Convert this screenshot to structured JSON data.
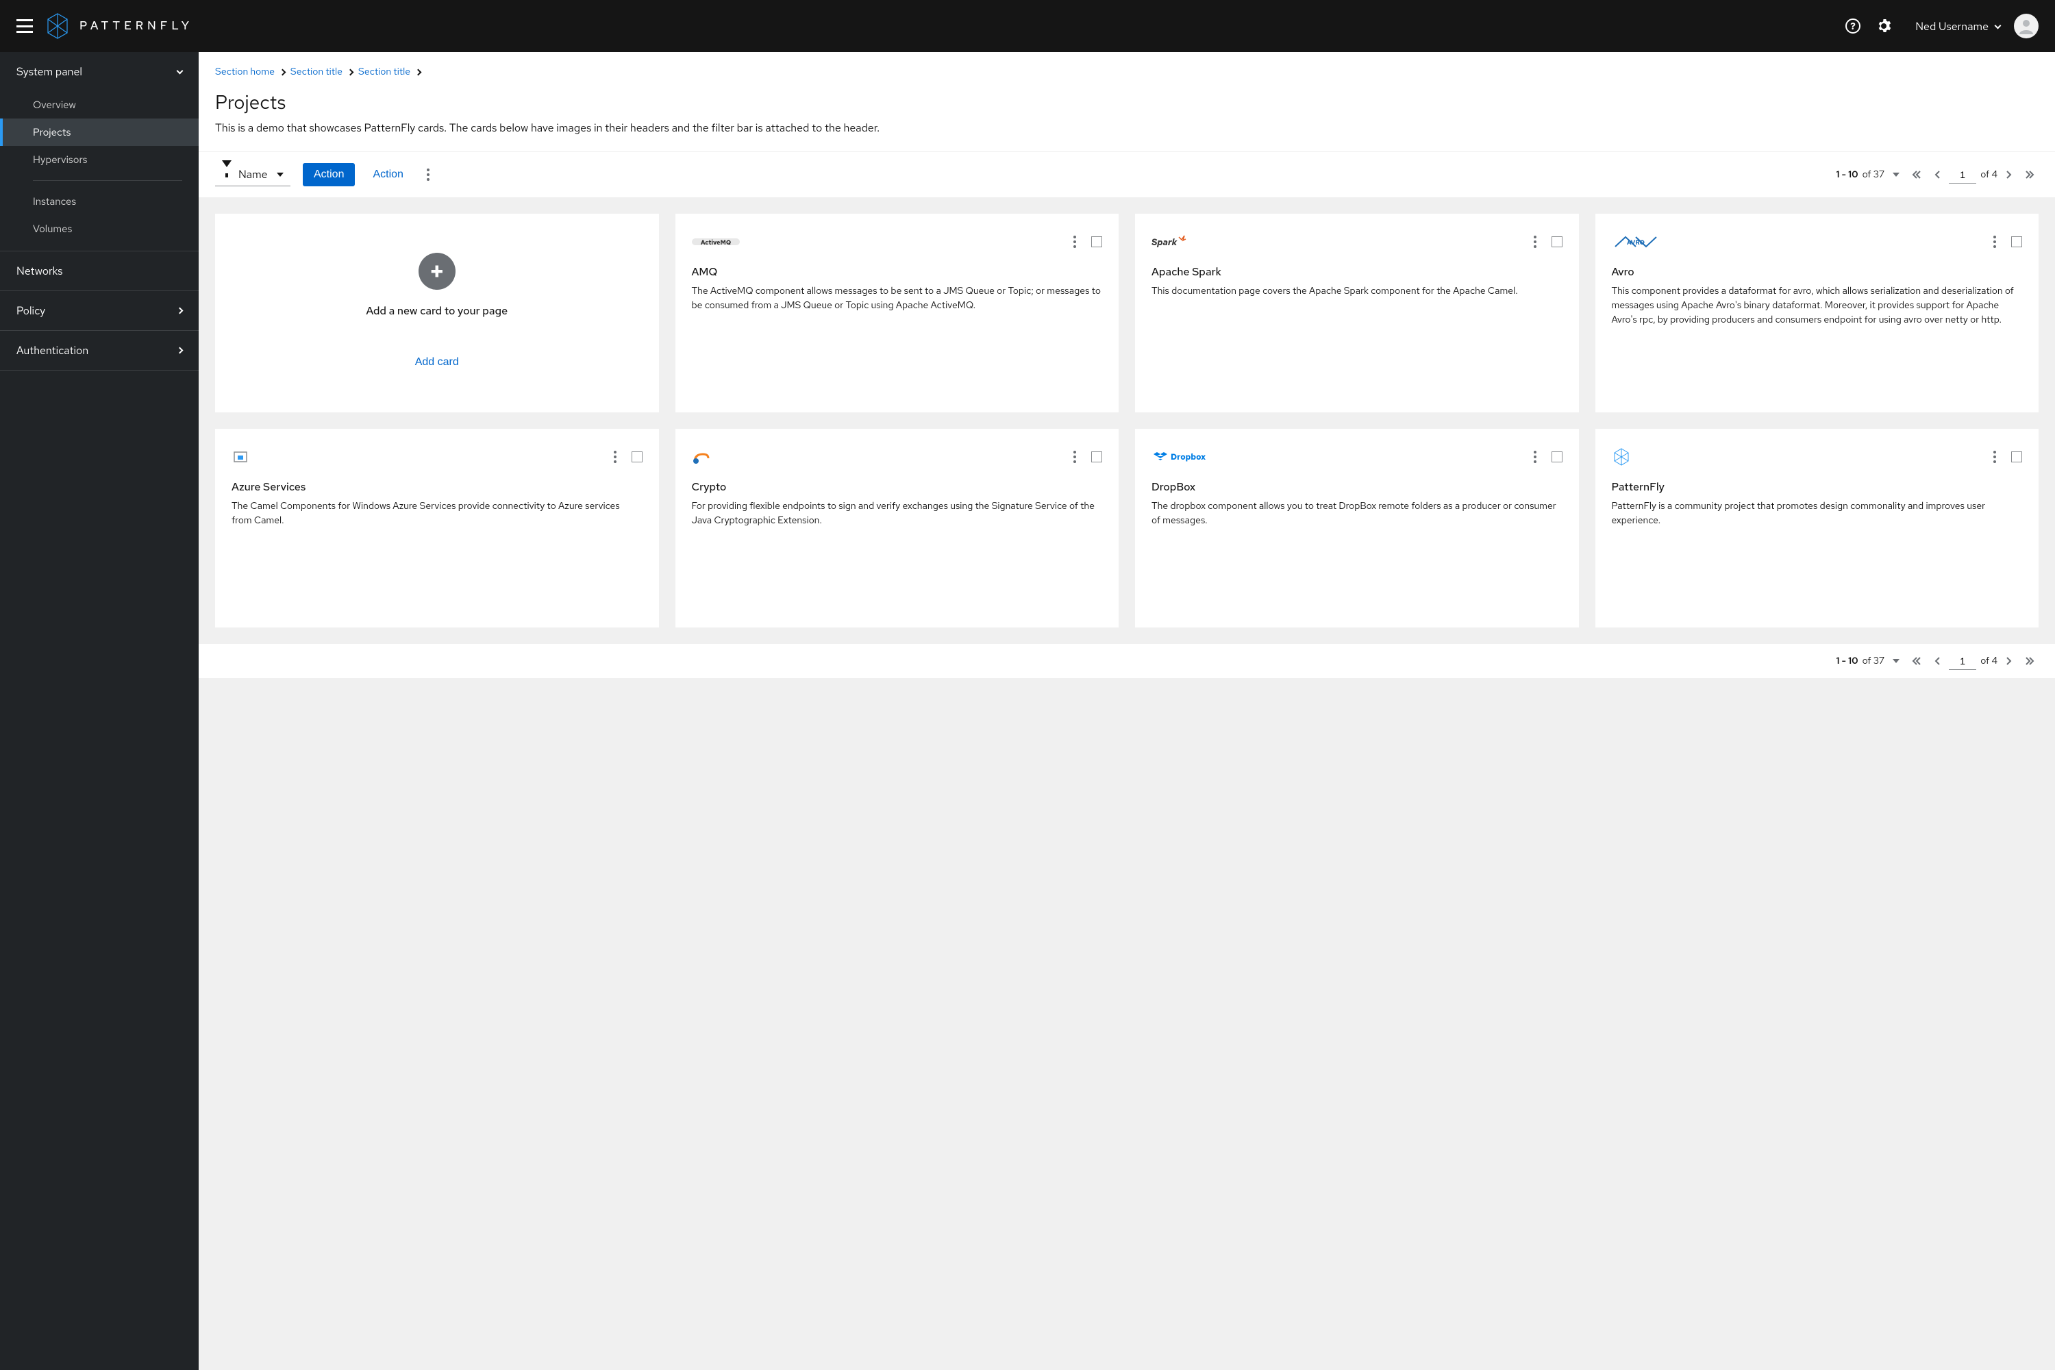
{
  "header": {
    "brand": "PATTERNFLY",
    "username": "Ned Username"
  },
  "sidebar": {
    "group1": {
      "label": "System panel",
      "items": [
        "Overview",
        "Projects",
        "Hypervisors",
        "Instances",
        "Volumes"
      ],
      "activeIndex": 1
    },
    "networks": "Networks",
    "policy": "Policy",
    "authentication": "Authentication"
  },
  "breadcrumbs": {
    "items": [
      "Section home",
      "Section title",
      "Section title"
    ]
  },
  "page": {
    "title": "Projects",
    "description": "This is a demo that showcases PatternFly cards. The cards below have images in their headers and the filter bar is attached to the header."
  },
  "toolbar": {
    "filter_label": "Name",
    "action_primary": "Action",
    "action_secondary": "Action"
  },
  "pagination": {
    "range": "1 - 10",
    "of_label": "of",
    "total": "37",
    "page_value": "1",
    "page_of_label": "of",
    "page_total": "4"
  },
  "addCard": {
    "title": "Add a new card to your page",
    "button": "Add card"
  },
  "cards": [
    {
      "logo": "activemq",
      "title": "AMQ",
      "body": "The ActiveMQ component allows messages to be sent to a JMS Queue or Topic; or messages to be consumed from a JMS Queue or Topic using Apache ActiveMQ."
    },
    {
      "logo": "spark",
      "title": "Apache Spark",
      "body": "This documentation page covers the Apache Spark component for the Apache Camel."
    },
    {
      "logo": "avro",
      "title": "Avro",
      "body": "This component provides a dataformat for avro, which allows serialization and deserialization of messages using Apache Avro's binary dataformat. Moreover, it provides support for Apache Avro's rpc, by providing producers and consumers endpoint for using avro over netty or http."
    },
    {
      "logo": "azure",
      "title": "Azure Services",
      "body": "The Camel Components for Windows Azure Services provide connectivity to Azure services from Camel."
    },
    {
      "logo": "crypto",
      "title": "Crypto",
      "body": "For providing flexible endpoints to sign and verify exchanges using the Signature Service of the Java Cryptographic Extension."
    },
    {
      "logo": "dropbox",
      "title": "DropBox",
      "body": "The dropbox component allows you to treat DropBox remote folders as a producer or consumer of messages."
    },
    {
      "logo": "patternfly",
      "title": "PatternFly",
      "body": "PatternFly is a community project that promotes design commonality and improves user experience."
    }
  ]
}
